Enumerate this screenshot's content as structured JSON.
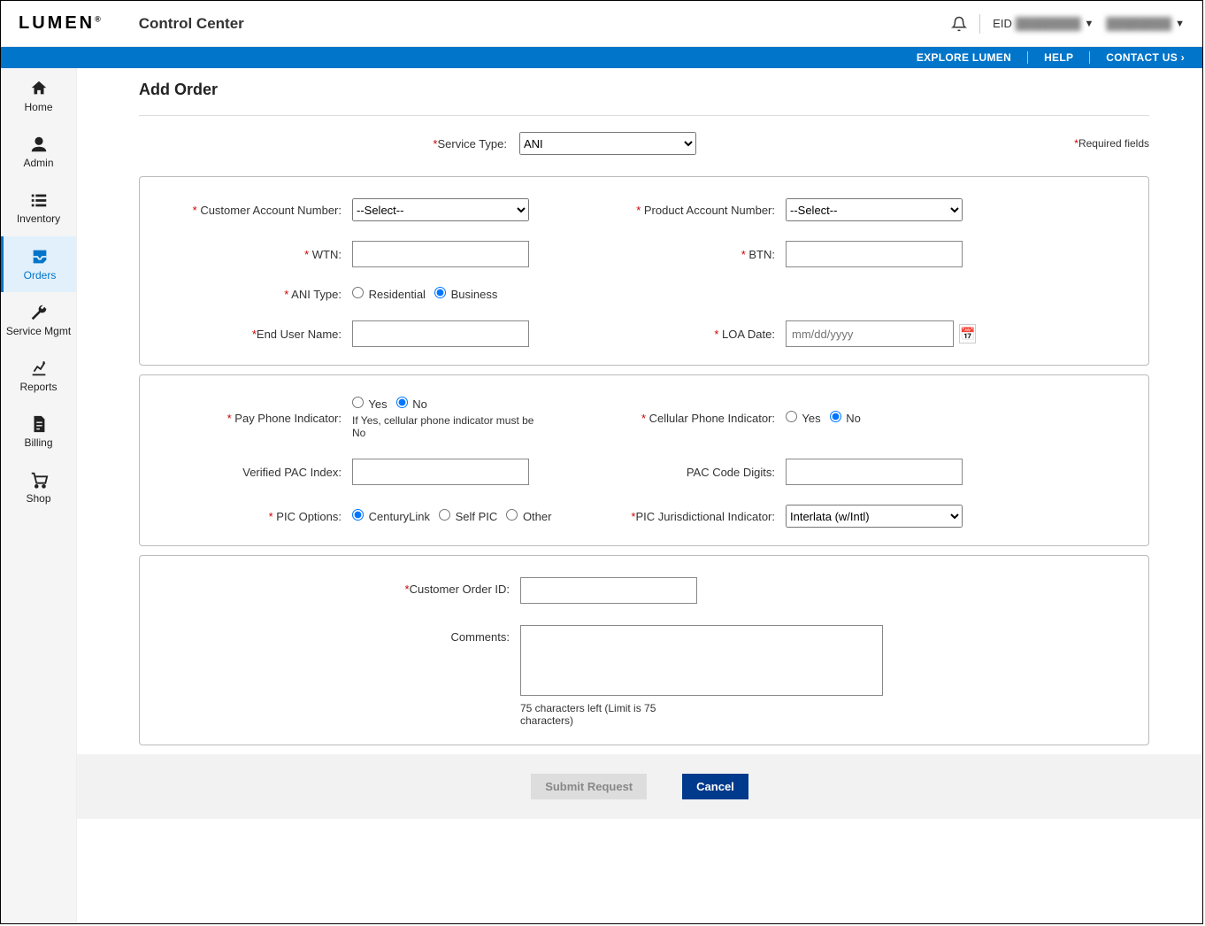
{
  "header": {
    "logo_text": "LUMEN",
    "app_title": "Control Center",
    "eid_label": "EID",
    "eid_value": "████████",
    "user_name": "████████"
  },
  "utilbar": {
    "explore": "EXPLORE LUMEN",
    "help": "HELP",
    "contact": "CONTACT US"
  },
  "nav": {
    "home": "Home",
    "admin": "Admin",
    "inventory": "Inventory",
    "orders": "Orders",
    "service_mgmt": "Service Mgmt",
    "reports": "Reports",
    "billing": "Billing",
    "shop": "Shop"
  },
  "page": {
    "title": "Add Order",
    "required_fields": "Required fields",
    "service_type_label": "Service Type:",
    "service_type_value": "ANI"
  },
  "panel1": {
    "cust_acct_label": "Customer Account Number:",
    "cust_acct_value": "--Select--",
    "prod_acct_label": "Product Account Number:",
    "prod_acct_value": "--Select--",
    "wtn_label": "WTN:",
    "btn_label": "BTN:",
    "ani_type_label": "ANI Type:",
    "ani_residential": "Residential",
    "ani_business": "Business",
    "end_user_label": "End User Name:",
    "loa_label": "LOA Date:",
    "loa_placeholder": "mm/dd/yyyy"
  },
  "panel2": {
    "payphone_label": "Pay Phone Indicator:",
    "yes": "Yes",
    "no": "No",
    "payphone_hint": "If Yes, cellular phone indicator must be No",
    "cellular_label": "Cellular Phone Indicator:",
    "pac_index_label": "Verified PAC Index:",
    "pac_digits_label": "PAC Code Digits:",
    "pic_options_label": "PIC Options:",
    "pic_centurylink": "CenturyLink",
    "pic_self": "Self PIC",
    "pic_other": "Other",
    "pic_juris_label": "PIC Jurisdictional Indicator:",
    "pic_juris_value": "Interlata (w/Intl)"
  },
  "panel3": {
    "cust_order_label": "Customer Order ID:",
    "comments_label": "Comments:",
    "char_note": "75 characters left (Limit is 75 characters)"
  },
  "footer": {
    "submit": "Submit Request",
    "cancel": "Cancel"
  }
}
